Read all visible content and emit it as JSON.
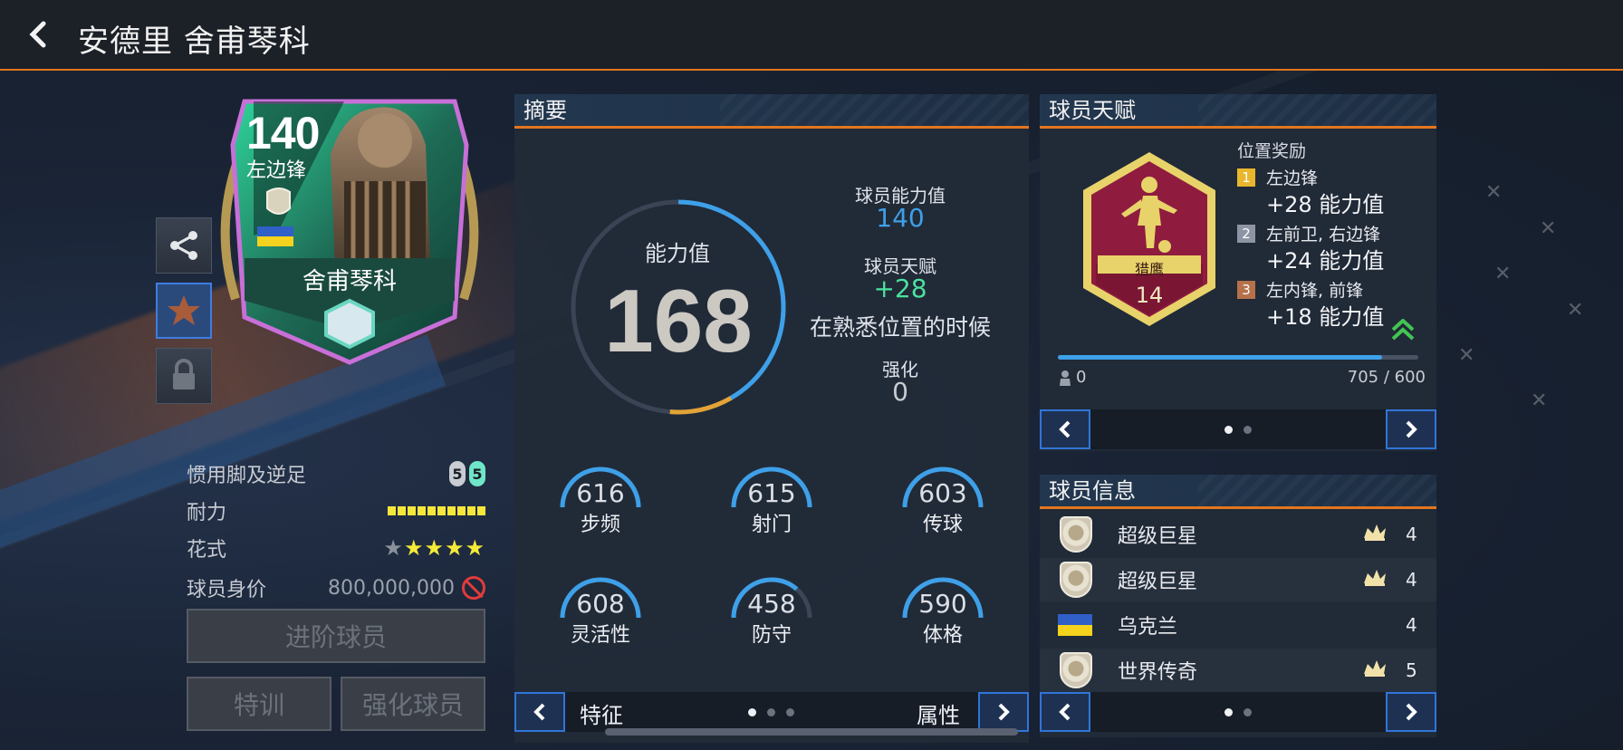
{
  "header": {
    "title": "安德里 舍甫琴科"
  },
  "card": {
    "rating": "140",
    "position": "左边锋",
    "name": "舍甫琴科"
  },
  "left_stats": {
    "foot_label": "惯用脚及逆足",
    "foot_weak": "5",
    "foot_strong": "5",
    "stamina_label": "耐力",
    "skill_label": "花式",
    "skill_stars": 4,
    "price_label": "球员身价",
    "price_value": "800,000,000"
  },
  "actions": {
    "advance": "进阶球员",
    "train": "特训",
    "upgrade": "强化球员"
  },
  "summary": {
    "title": "摘要",
    "ovr_label": "能力值",
    "ovr_value": "168",
    "player_rating_label": "球员能力值",
    "player_rating_value": "140",
    "talent_label": "球员天赋",
    "talent_value": "+28",
    "talent_note": "在熟悉位置的时候",
    "enhance_label": "强化",
    "enhance_value": "0",
    "stats": [
      {
        "value": "616",
        "label": "步频",
        "fill": 0.95
      },
      {
        "value": "615",
        "label": "射门",
        "fill": 0.95
      },
      {
        "value": "603",
        "label": "传球",
        "fill": 0.95
      },
      {
        "value": "608",
        "label": "灵活性",
        "fill": 0.95
      },
      {
        "value": "458",
        "label": "防守",
        "fill": 0.6
      },
      {
        "value": "590",
        "label": "体格",
        "fill": 0.95
      }
    ],
    "nav_left_label": "特征",
    "nav_right_label": "属性"
  },
  "talent": {
    "title": "球员天赋",
    "badge_name": "猎鹰",
    "badge_level": "14",
    "bonus_title": "位置奖励",
    "bonuses": [
      {
        "rank": "1",
        "positions": "左边锋",
        "value": "+28 能力值",
        "color": "#e9b72d"
      },
      {
        "rank": "2",
        "positions": "左前卫, 右边锋",
        "value": "+24 能力值",
        "color": "#8d95a5"
      },
      {
        "rank": "3",
        "positions": "左内锋, 前锋",
        "value": "+18 能力值",
        "color": "#b5714a"
      }
    ],
    "progress_left": "0",
    "progress_right": "705 / 600",
    "progress_fill": 0.9
  },
  "info": {
    "title": "球员信息",
    "rows": [
      {
        "label": "超级巨星",
        "count": "4",
        "type": "badge"
      },
      {
        "label": "超级巨星",
        "count": "4",
        "type": "badge"
      },
      {
        "label": "乌克兰",
        "count": "4",
        "type": "flag"
      },
      {
        "label": "世界传奇",
        "count": "5",
        "type": "badge"
      }
    ]
  },
  "colors": {
    "accent": "#e2761f",
    "blue": "#3ea0e8",
    "green": "#4be2a0",
    "gold": "#e3a336"
  }
}
